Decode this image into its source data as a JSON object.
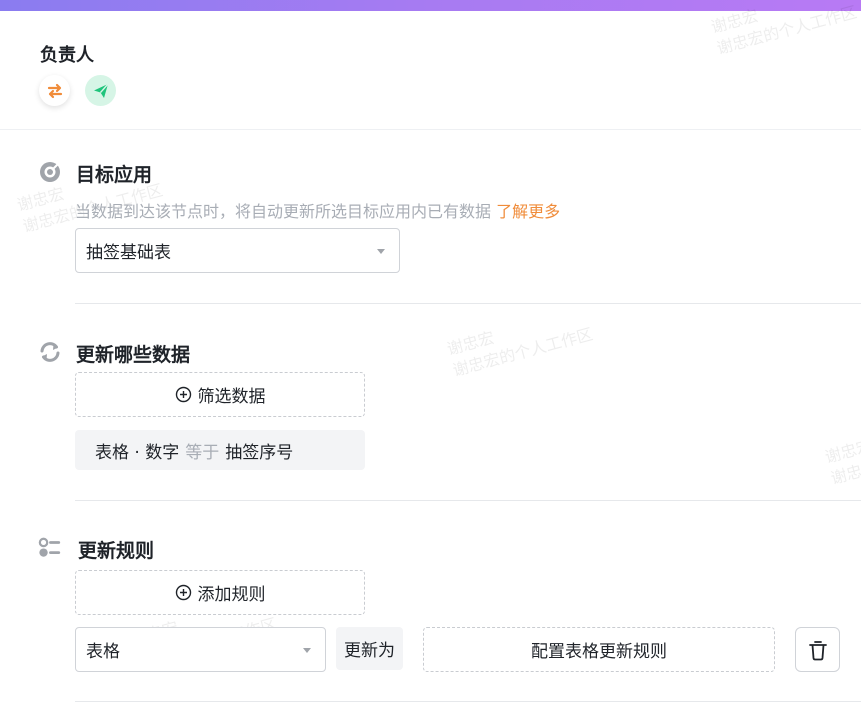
{
  "owner": {
    "title": "负责人",
    "icons": [
      "swap-icon",
      "send-icon"
    ]
  },
  "watermark": "谢忠宏的个人工作区",
  "target_app": {
    "title": "目标应用",
    "hint": "当数据到达该节点时，将自动更新所选目标应用内已有数据",
    "hint_link": "了解更多",
    "select_value": "抽签基础表"
  },
  "update_data": {
    "title": "更新哪些数据",
    "filter_button": "筛选数据",
    "condition": {
      "field": "表格 · 数字",
      "operator": "等于",
      "value": "抽签序号"
    }
  },
  "update_rules": {
    "title": "更新规则",
    "add_button": "添加规则",
    "rule": {
      "field_select": "表格",
      "update_to": "更新为",
      "config_button": "配置表格更新规则"
    }
  },
  "colors": {
    "accent_orange": "#f08c3a",
    "accent_green": "#1ec47b",
    "gradient": [
      "#8a7cf0",
      "#b87af4"
    ]
  }
}
